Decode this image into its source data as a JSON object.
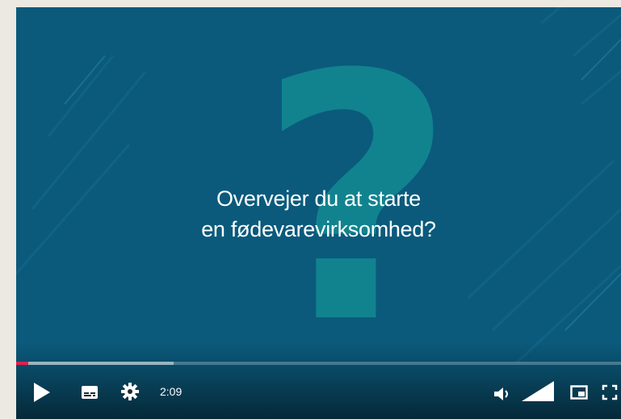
{
  "video": {
    "headline_line1": "Overvejer du at starte",
    "headline_line2": "en fødevarevirksomhed?",
    "background_color": "#0b5a7c",
    "accent_question_mark": "?",
    "accent_color": "#11838f"
  },
  "controls": {
    "play_icon": "play-icon",
    "captions_icon": "captions-icon",
    "settings_icon": "gear-icon",
    "time": "2:09",
    "volume_icon": "volume-icon",
    "volume_level": 1.0,
    "miniplayer_icon": "miniplayer-icon",
    "fullscreen_icon": "fullscreen-icon",
    "progress_played_fraction": 0.02,
    "progress_buffered_fraction": 0.26,
    "progress_color": "#e0204d"
  }
}
